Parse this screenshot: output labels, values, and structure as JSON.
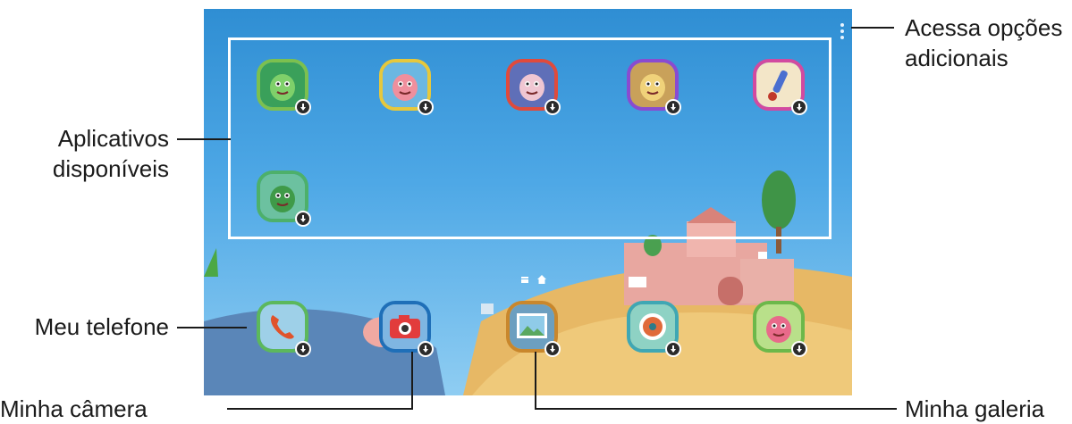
{
  "callouts": {
    "more_options": [
      "Acessa opções",
      "adicionais"
    ],
    "available_apps": [
      "Aplicativos",
      "disponíveis"
    ],
    "my_phone": "Meu telefone",
    "my_camera": "Minha câmera",
    "my_gallery": "Minha galeria"
  },
  "colors": {
    "sky_top": "#2f8ed3",
    "sky_bottom": "#8fcdf2",
    "hill": "#e9bf6b",
    "frame": "#ffffff",
    "badge": "#2b2b2b"
  },
  "available_apps": [
    {
      "icon": "dinosaur-character-icon",
      "border": "#7cc04f",
      "bg": "#3aa05a",
      "glyph": "#7fd06a"
    },
    {
      "icon": "pink-character-icon",
      "border": "#e6c83c",
      "bg": "#6bb7e2",
      "glyph": "#ef8f9d"
    },
    {
      "icon": "bird-character-icon",
      "border": "#e04a3c",
      "bg": "#5f6fb8",
      "glyph": "#f0c6d2"
    },
    {
      "icon": "yellow-character-icon",
      "border": "#8a4bd0",
      "bg": "#c9a15a",
      "glyph": "#f0d27a"
    },
    {
      "icon": "brush-tool-icon",
      "border": "#d24aa0",
      "bg": "#f3e6c8",
      "glyph": "#4a6fd0"
    },
    {
      "icon": "dinosaur-drawing-icon",
      "border": "#4db06a",
      "bg": "#6cc1a0",
      "glyph": "#3f9a48"
    }
  ],
  "dock_apps": [
    {
      "icon": "phone-icon",
      "border": "#5cb85c",
      "bg": "#9ed0e8",
      "glyph": "#e0532b"
    },
    {
      "icon": "camera-icon",
      "border": "#1f6fb8",
      "bg": "#7fb6e2",
      "glyph": "#e23c3c"
    },
    {
      "icon": "gallery-icon",
      "border": "#c9872c",
      "bg": "#6c9fc0",
      "glyph": "#5aa860"
    },
    {
      "icon": "compass-game-icon",
      "border": "#3fa7b4",
      "bg": "#8ed2c4",
      "glyph": "#e06a3a"
    },
    {
      "icon": "cartoon-character-icon",
      "border": "#6cb84a",
      "bg": "#b9e08a",
      "glyph": "#e86a8a"
    }
  ]
}
